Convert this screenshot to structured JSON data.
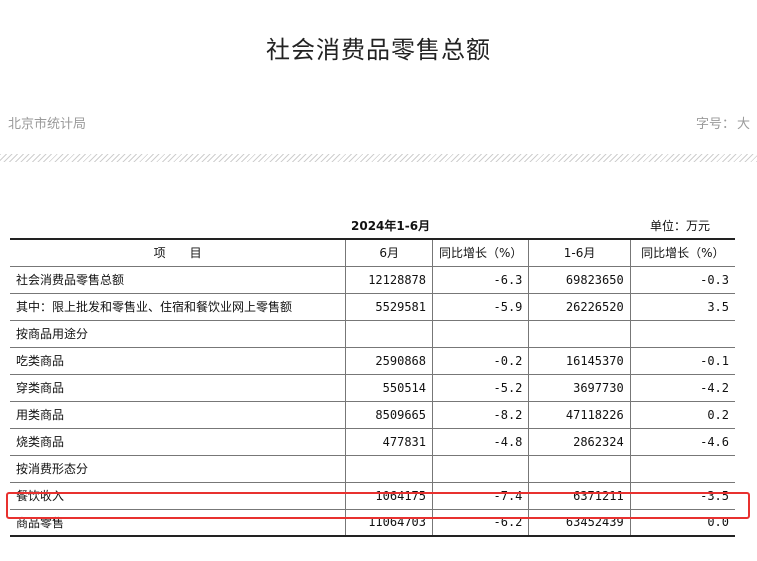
{
  "page": {
    "title": "社会消费品零售总额",
    "source": "北京市统计局",
    "font_size_label": "字号：",
    "font_size_value": "大"
  },
  "table": {
    "period": "2024年1-6月",
    "unit": "单位：万元",
    "headers": [
      "项　　目",
      "6月",
      "同比增长（%）",
      "1-6月",
      "同比增长（%）"
    ],
    "rows": [
      {
        "label": "社会消费品零售总额",
        "bold": true,
        "indent": 0,
        "cells": [
          "12128878",
          "-6.3",
          "69823650",
          "-0.3"
        ]
      },
      {
        "label": "其中：限上批发和零售业、住宿和餐饮业网上零售额",
        "bold": false,
        "indent": 1,
        "cells": [
          "5529581",
          "-5.9",
          "26226520",
          "3.5"
        ]
      },
      {
        "label": "按商品用途分",
        "bold": true,
        "indent": 0,
        "cells": [
          "",
          "",
          "",
          ""
        ]
      },
      {
        "label": "吃类商品",
        "bold": false,
        "indent": 1,
        "cells": [
          "2590868",
          "-0.2",
          "16145370",
          "-0.1"
        ]
      },
      {
        "label": "穿类商品",
        "bold": false,
        "indent": 1,
        "cells": [
          "550514",
          "-5.2",
          "3697730",
          "-4.2"
        ]
      },
      {
        "label": "用类商品",
        "bold": false,
        "indent": 1,
        "cells": [
          "8509665",
          "-8.2",
          "47118226",
          "0.2"
        ]
      },
      {
        "label": "烧类商品",
        "bold": false,
        "indent": 1,
        "cells": [
          "477831",
          "-4.8",
          "2862324",
          "-4.6"
        ]
      },
      {
        "label": "按消费形态分",
        "bold": true,
        "indent": 0,
        "cells": [
          "",
          "",
          "",
          ""
        ]
      },
      {
        "label": "餐饮收入",
        "bold": false,
        "indent": 1,
        "highlight": true,
        "cells": [
          "1064175",
          "-7.4",
          "6371211",
          "-3.5"
        ]
      },
      {
        "label": "商品零售",
        "bold": false,
        "indent": 1,
        "cells": [
          "11064703",
          "-6.2",
          "63452439",
          "0.0"
        ]
      }
    ]
  },
  "colors": {
    "highlight_border": "#e8312f",
    "meta_text": "#9a9a9a"
  }
}
